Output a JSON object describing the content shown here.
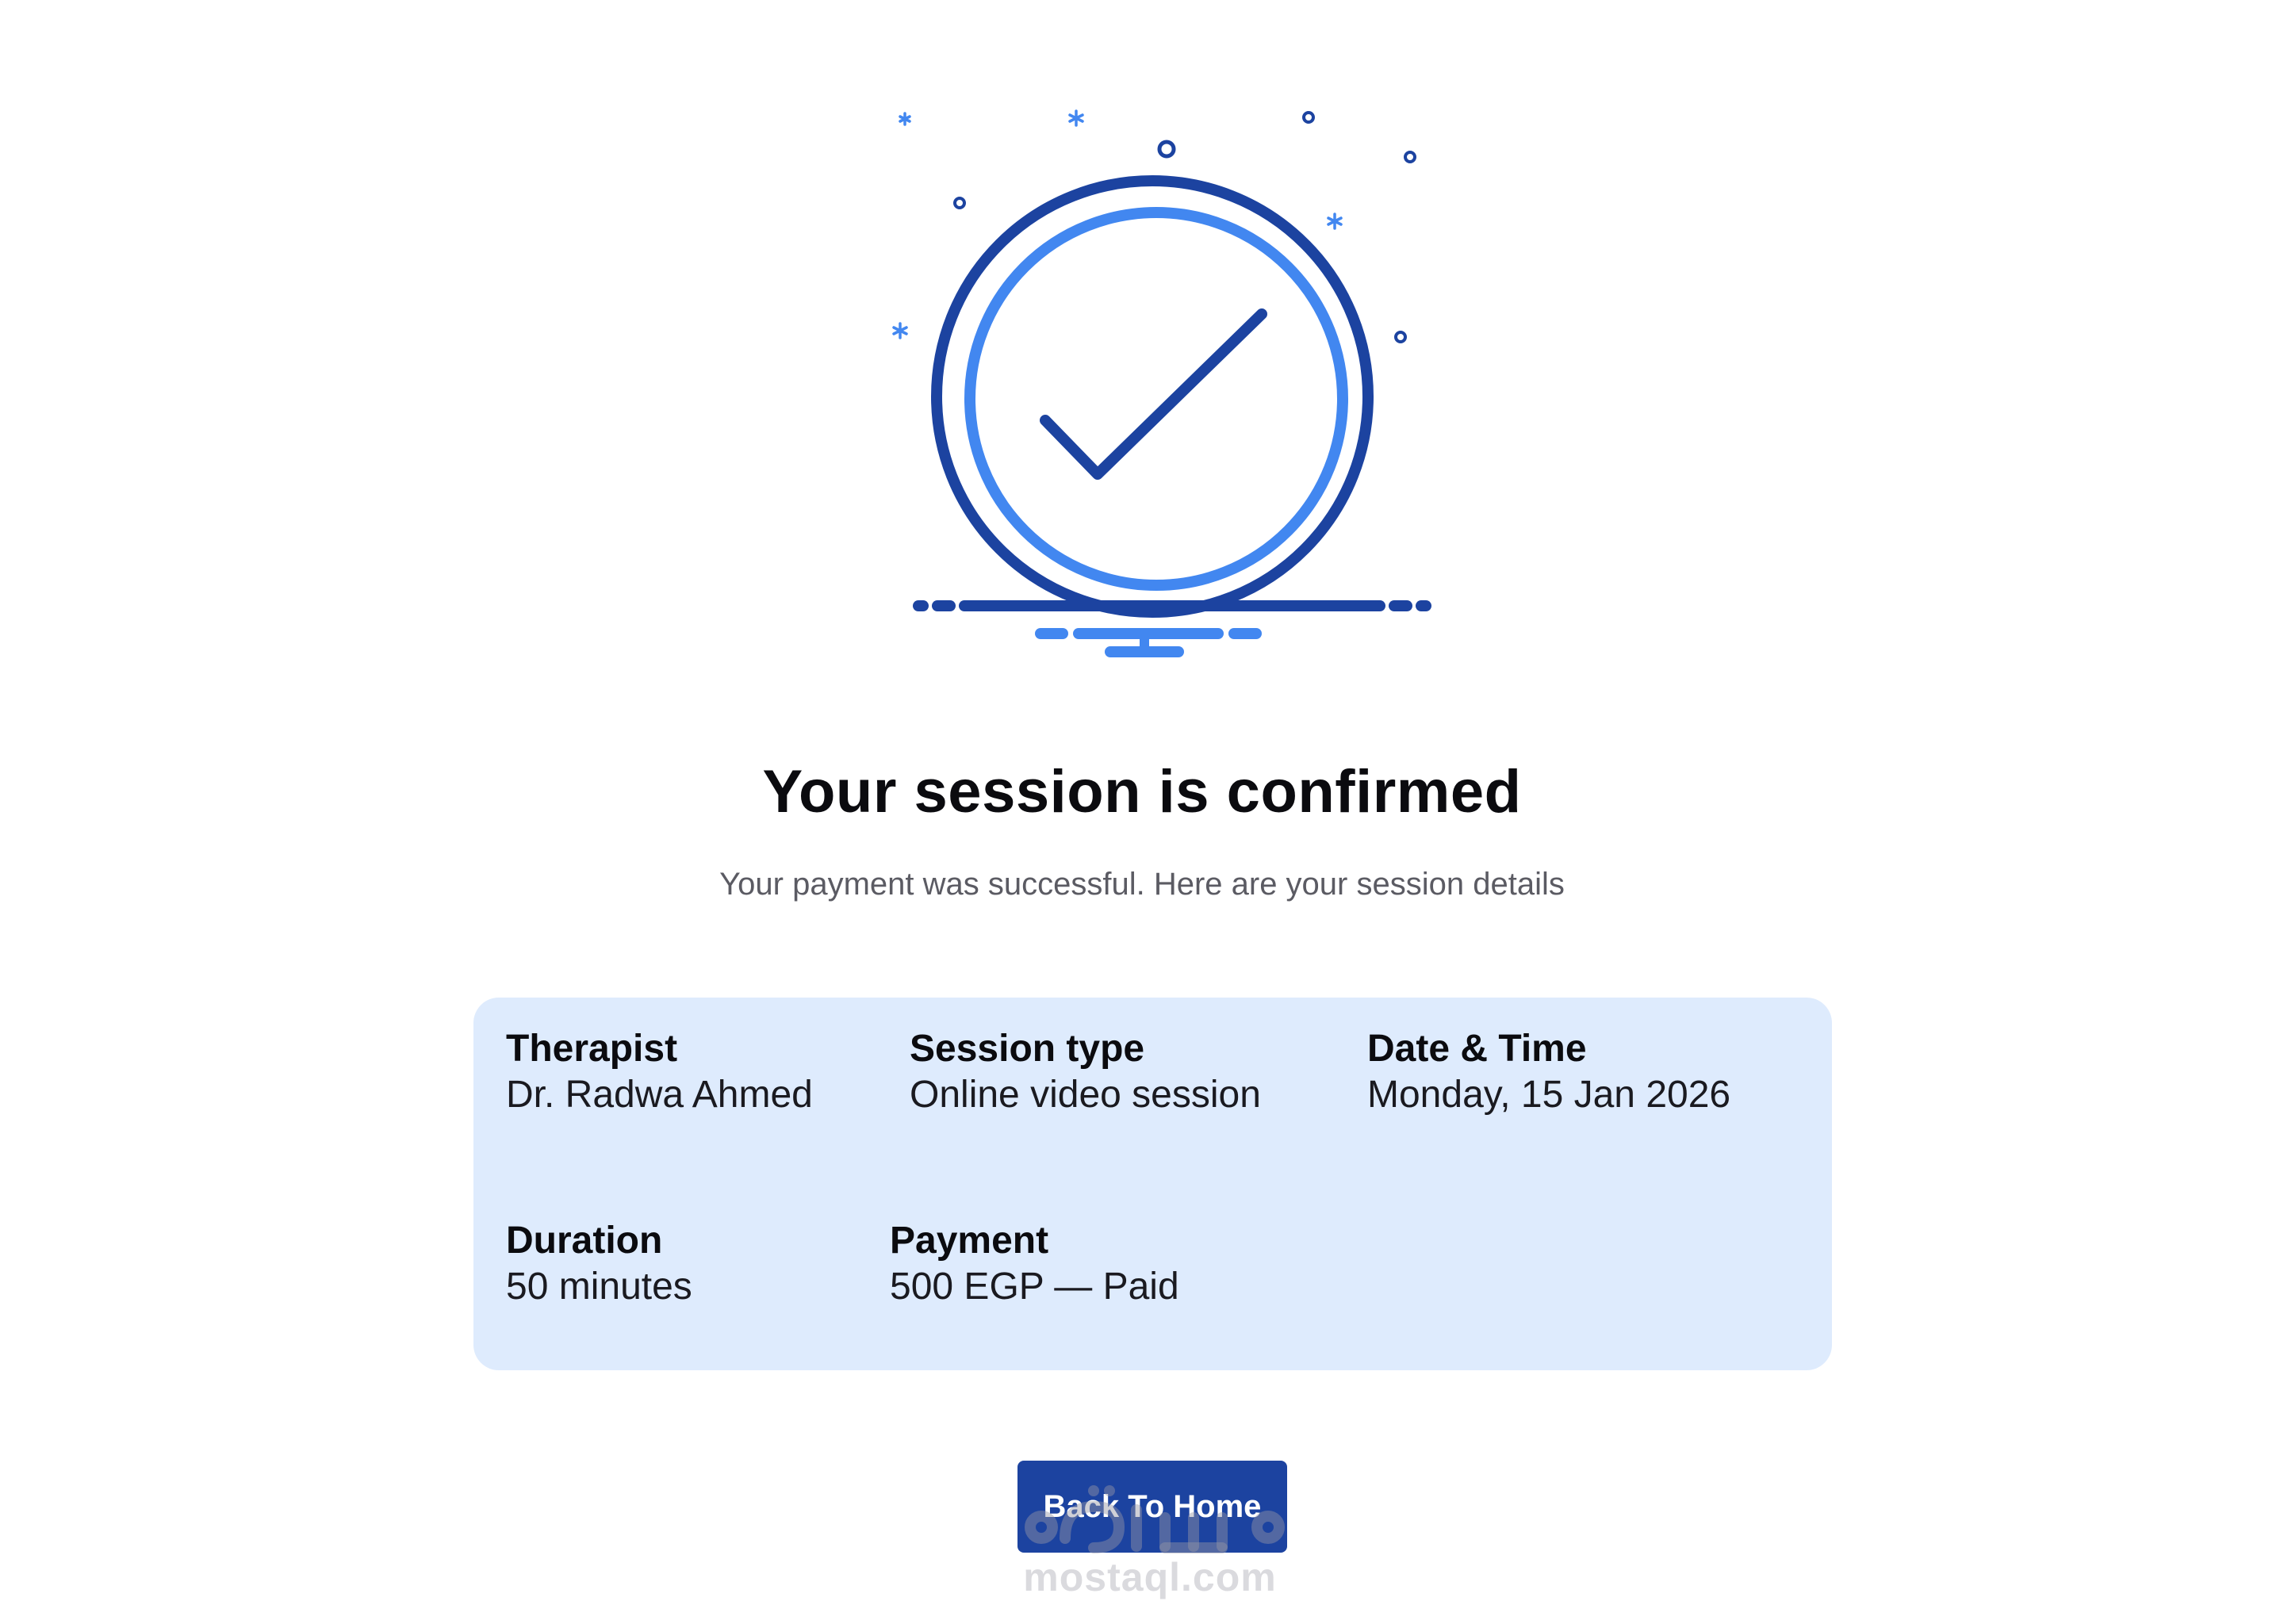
{
  "confirmation": {
    "title": "Your session is confirmed",
    "subtitle": "Your payment was successful. Here are your session details"
  },
  "details": {
    "therapist": {
      "label": "Therapist",
      "value": "Dr. Radwa Ahmed"
    },
    "session_type": {
      "label": "Session type",
      "value": "Online video session"
    },
    "date_time": {
      "label": "Date & Time",
      "value": "Monday, 15 Jan 2026"
    },
    "duration": {
      "label": "Duration",
      "value": "50 minutes"
    },
    "payment": {
      "label": "Payment",
      "value": "500 EGP — Paid"
    }
  },
  "actions": {
    "home_label": "Back To Home"
  },
  "watermark": {
    "site": "mostaql.com"
  },
  "icons": {
    "illustration": "check-circle-icon",
    "sparkles": "sparkle-icon"
  },
  "colors": {
    "primary": "#1c43a0",
    "accent": "#4287f0",
    "card_background": "#deebfd",
    "subtitle_text": "#5b5b63"
  }
}
